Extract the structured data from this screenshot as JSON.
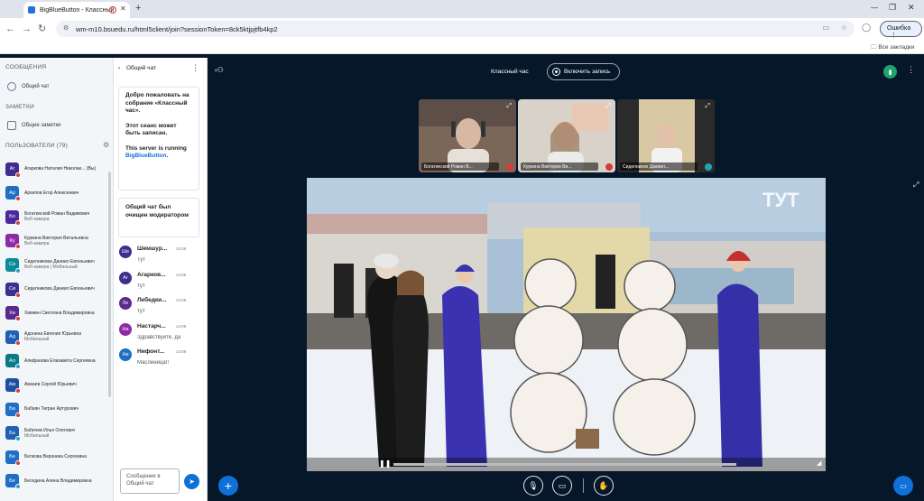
{
  "browser": {
    "tab_title": "BigBlueButton - Классный",
    "new_tab": "+",
    "url": "wm-m10.bsuedu.ru/html5client/join?sessionToken=8ck5ktjpjtfb4kp2",
    "error_label": "Ошибка",
    "bookmarks_label": "Все закладки"
  },
  "sidebar": {
    "messages_heading": "СООБЩЕНИЯ",
    "public_chat": "Общий чат",
    "notes_heading": "ЗАМЕТКИ",
    "shared_notes": "Общие заметки",
    "users_heading": "ПОЛЬЗОВАТЕЛИ (79)",
    "users": [
      {
        "initials": "Аг",
        "name": "Агаркова Наталия Николае... (Вы)",
        "sub": "",
        "color": "#3f2d8f",
        "status": "#d63b3b"
      },
      {
        "initials": "Ар",
        "name": "Архипов Егор Алексеевич",
        "sub": "",
        "color": "#1f6fc5",
        "status": "#d63b3b"
      },
      {
        "initials": "Бо",
        "name": "Богатинский Роман Вадимович",
        "sub": "Веб-камера",
        "color": "#4a2a9a",
        "status": "#d63b3b"
      },
      {
        "initials": "Ку",
        "name": "Куркина Виктория Витальевна",
        "sub": "Веб-камера",
        "color": "#8e2aa8",
        "status": "#d63b3b"
      },
      {
        "initials": "Си",
        "name": "Сиделникова Даниил Евгеньевич",
        "sub": "Веб-камера | Мобильный",
        "color": "#0a8a9a",
        "status": "#1fa3b5"
      },
      {
        "initials": "Си",
        "name": "Сиделникова Даниил Евгеньевич",
        "sub": "",
        "color": "#3f2d8f",
        "status": "#d63b3b"
      },
      {
        "initials": "Хи",
        "name": "Химиен Светлана Владимировна",
        "sub": "",
        "color": "#5a2a8f",
        "status": "#d63b3b"
      },
      {
        "initials": "Ад",
        "name": "Адонина Евгения Юрьевна",
        "sub": "Мобильный",
        "color": "#1f5fb5",
        "status": "#d63b3b"
      },
      {
        "initials": "Ал",
        "name": "Алифанова Елизавета Сергеевна",
        "sub": "",
        "color": "#0a7a8a",
        "status": "#1fa3b5"
      },
      {
        "initials": "Ам",
        "name": "Амзаев Сергей Юрьевич",
        "sub": "",
        "color": "#1f4fa5",
        "status": "#d63b3b"
      },
      {
        "initials": "Ба",
        "name": "Бабаян Тигран Артурович",
        "sub": "",
        "color": "#1f6fc5",
        "status": "#d63b3b"
      },
      {
        "initials": "Ба",
        "name": "Бабичев Илья Олегович",
        "sub": "Мобильный",
        "color": "#1f5fb5",
        "status": "#1fa3b5"
      },
      {
        "initials": "Бе",
        "name": "Белкова Вероника Сергеевна",
        "sub": "",
        "color": "#1f6fc5",
        "status": "#d63b3b"
      },
      {
        "initials": "Бе",
        "name": "Беседина Алина Владимировна",
        "sub": "",
        "color": "#1f6fc5",
        "status": "#1fa3b5"
      }
    ]
  },
  "chat": {
    "title": "Общий чат",
    "welcome_1": "Добро пожаловать на собрание «Классный час».",
    "welcome_2": "Этот сеанс может быть записан.",
    "welcome_3": "This server is running",
    "welcome_link": "BigBlueButton",
    "welcome_link_dot": ".",
    "cleared": "Общий чат был очищен модератором",
    "messages": [
      {
        "initials": "Ше",
        "name": "Шемшур...",
        "time": "14:06",
        "text": "Тут",
        "color": "#3f2d8f"
      },
      {
        "initials": "Аг",
        "name": "Агарков...",
        "time": "14:06",
        "text": "тут",
        "color": "#3f2d8f"
      },
      {
        "initials": "Ле",
        "name": "Лебедки...",
        "time": "14:08",
        "text": "тут",
        "color": "#5a2a8f"
      },
      {
        "initials": "На",
        "name": "Настарч...",
        "time": "14:09",
        "text": "Здравствуйте, да",
        "color": "#8e2aa8"
      },
      {
        "initials": "Ни",
        "name": "Нифонт...",
        "time": "14:09",
        "text": "Масленица!!",
        "color": "#1f6fc5"
      }
    ],
    "input_placeholder": "Сообщение в Общий чат"
  },
  "meeting": {
    "title": "Классный час",
    "record_label": "Включить запись",
    "cameras": [
      {
        "name": "Богатинский Роман В...",
        "mic_color": "#d63b3b"
      },
      {
        "name": "Куркина Виктория Ви...",
        "mic_color": "#d63b3b"
      },
      {
        "name": "Сиделников Даниил...",
        "mic_color": "#1fa3b5"
      }
    ],
    "video_watermark": "ТУТ"
  },
  "colors": {
    "primary": "#0f70d7",
    "dark_bg": "#06172a",
    "connection": "#1fa36d"
  }
}
